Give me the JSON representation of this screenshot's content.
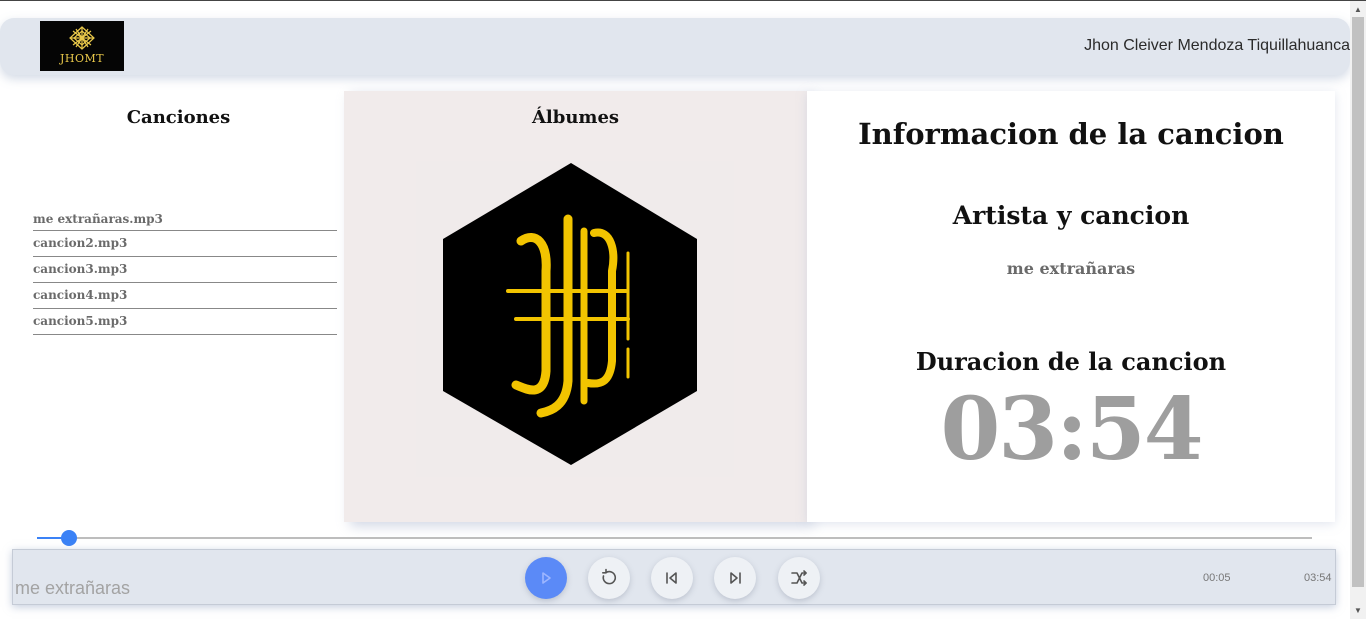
{
  "header": {
    "logo_text": "JHOMT",
    "user_name": "Jhon Cleiver Mendoza Tiquillahuanca"
  },
  "songs_panel": {
    "title": "Canciones",
    "items": [
      "me extrañaras.mp3",
      "cancion2.mp3",
      "cancion3.mp3",
      "cancion4.mp3",
      "cancion5.mp3"
    ]
  },
  "albums_panel": {
    "title": "Álbumes"
  },
  "info_panel": {
    "title": "Informacion de la cancion",
    "artist_song_heading": "Artista y cancion",
    "song_name": "me extrañaras",
    "duration_heading": "Duracion de la cancion",
    "duration": "03:54"
  },
  "player": {
    "now_playing": "me extrañaras",
    "current_time": "00:05",
    "total_time": "03:54",
    "progress_fraction": 0.025,
    "controls": [
      "play-icon",
      "replay-icon",
      "skip-previous-icon",
      "skip-next-icon",
      "shuffle-icon"
    ]
  },
  "colors": {
    "accent": "#3b82f6",
    "play_button": "#5b8af7",
    "header_bg": "#e1e6ee",
    "album_bg": "#f1ebeb",
    "logo_gold": "#e9c84a"
  }
}
